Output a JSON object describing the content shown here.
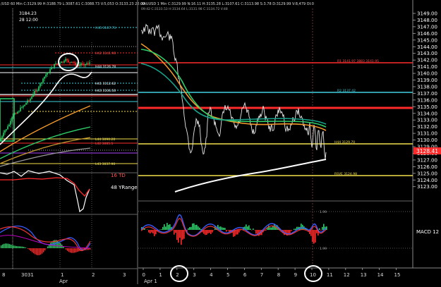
{
  "left_chart": {
    "header": "/USD  60 Min  C:3129.99  H:3188.79  L:3087.61  C:3088.73  V:5,053  O:3133.23  22:00",
    "header_short": "USD  60 Min",
    "date_price": "3184.23",
    "date_time": "28 12:00",
    "level_labels": [
      "H45 3167.73",
      "H42 3141.98",
      "H44 3126.78",
      "H41 3112.62",
      "H43 3106.50",
      "L44 3090.20",
      "L42 3085.5",
      "L43 3037.90"
    ],
    "osc_top_label": "16 TD",
    "osc_bottom_label": "48 YRange",
    "axis_labels": [
      "8",
      "3031",
      "1",
      "2",
      "3"
    ],
    "month_label": "Apr"
  },
  "right_chart": {
    "header": "XAUUSD  1 Min  C:3129.99  N:16.11  H:3135.28  L:3107.61  C:3113.98  S:3.78  D:3129.99  V:8,479  OI:0",
    "subheader": "09:42  C:3133.53  H:3134.64  L:3131.98  C:3134.72  V:48",
    "price_ticks": [
      "3149.00",
      "3148.00",
      "3147.00",
      "3146.00",
      "3145.00",
      "3144.00",
      "3143.00",
      "3142.00",
      "3141.00",
      "3140.00",
      "3139.00",
      "3138.00",
      "3137.00",
      "3136.00",
      "3135.00",
      "3134.00",
      "3133.00",
      "3132.00",
      "3131.00",
      "3130.00",
      "3129.00",
      "3128.00",
      "3127.00",
      "3126.00",
      "3125.00",
      "3124.00",
      "3123.00"
    ],
    "current_price": "3128.41",
    "level_labels": [
      "R1 3141.97  3883  3141.95",
      "R2 3137.42",
      "H44 3129.70",
      "RSVE 3124.98"
    ],
    "macd_label": "MACD 12",
    "macd_ticks": [
      "1.99",
      "1.99"
    ],
    "x_labels": [
      "0",
      "1",
      "2",
      "3",
      "4",
      "5",
      "6",
      "7",
      "8",
      "9",
      "10",
      "11",
      "12",
      "13",
      "14",
      "15"
    ],
    "date_label": "Apr 1"
  },
  "colors": {
    "background": "#000000",
    "price_line": "#e6e6e6",
    "red_level": "#ff2a2a",
    "cyan_level": "#3fd0e0",
    "yellow_level": "#f2e04a",
    "ma_orange": "#f39a2b",
    "ma_green": "#2ecf6a",
    "ma_teal": "#17a38c",
    "ma_white": "#ffffff",
    "osc_red": "#e33",
    "osc_blue": "#3b5bff",
    "osc_magenta": "#c000c0"
  }
}
